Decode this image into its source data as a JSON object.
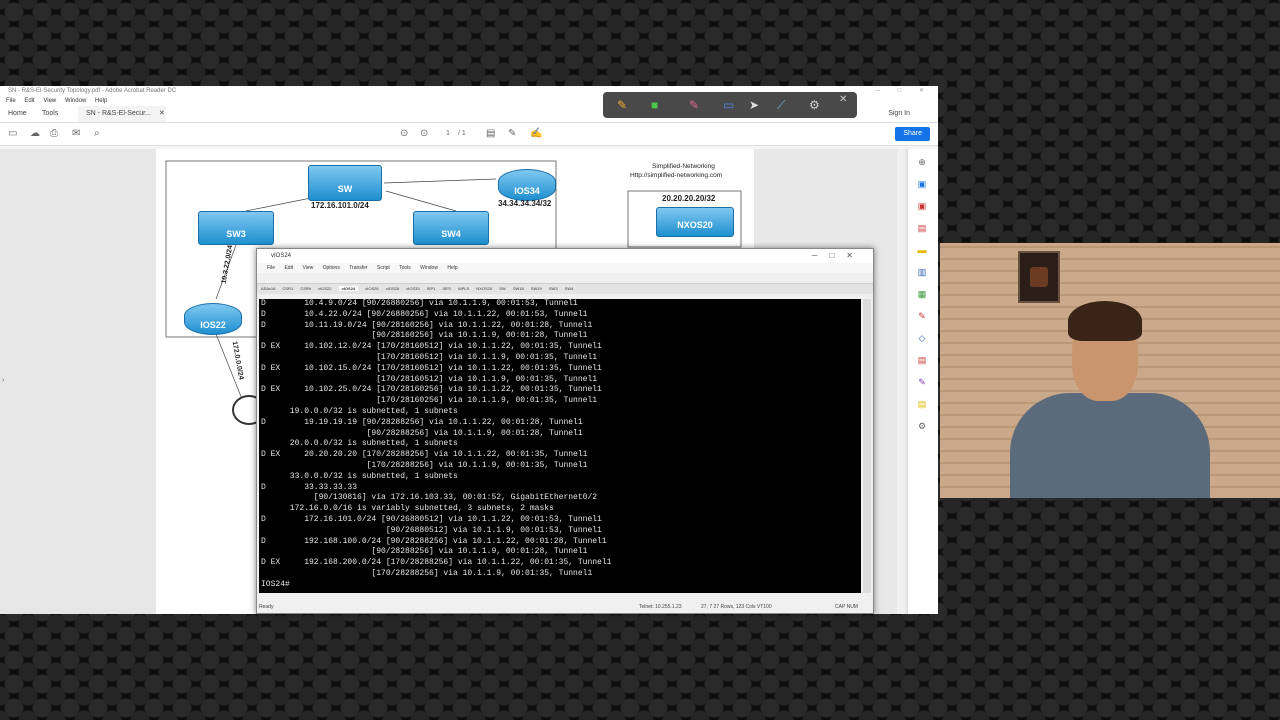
{
  "acrobat": {
    "window_title": "SN - R&S-El-Security Topology.pdf - Adobe Acrobat Reader DC",
    "menu": [
      "File",
      "Edit",
      "View",
      "Window",
      "Help"
    ],
    "tab_home": "Home",
    "tab_tools": "Tools",
    "tab_doc": "SN - R&S-El-Secur...",
    "signin": "Sign In",
    "page_current": "1",
    "page_total": "/ 1",
    "share": "Share"
  },
  "topology": {
    "sw_label": "SW",
    "sw_subnet": "172.16.101.0/24",
    "sw3_label": "SW3",
    "sw4_label": "SW4",
    "ios34_label": "IOS34",
    "ios34_subnet": "34.34.34.34/32",
    "ios22_label": "IOS22",
    "link1": "10.3.22.0/24",
    "link2": "172.0.0.0/24",
    "brand": "Simplified-Networking",
    "url": "Http://simplified-networking.com",
    "nxos20_subnet": "20.20.20.20/32",
    "nxos20_label": "NXOS20"
  },
  "crt": {
    "window_title": "vIOS24",
    "menu": [
      "File",
      "Edit",
      "View",
      "Options",
      "Transfer",
      "Script",
      "Tools",
      "Window",
      "Help"
    ],
    "tabs": [
      "ASAv16",
      "CSR1",
      "CSR9",
      "vIOS22",
      "vIOS24",
      "vIOS26",
      "vIOS28",
      "vIOS33",
      "ISP1",
      "ISP2",
      "MPLS",
      "NXOS20",
      "SW",
      "SW18",
      "SW19",
      "SW3",
      "SW4"
    ],
    "active_tab": "vIOS24",
    "terminal_lines": [
      "D        10.4.9.0/24 [90/26880256] via 10.1.1.9, 00:01:53, Tunnel1",
      "D        10.4.22.0/24 [90/26880256] via 10.1.1.22, 00:01:53, Tunnel1",
      "D        10.11.19.0/24 [90/28160256] via 10.1.1.22, 00:01:28, Tunnel1",
      "                       [90/28160256] via 10.1.1.9, 00:01:28, Tunnel1",
      "D EX     10.102.12.0/24 [170/28160512] via 10.1.1.22, 00:01:35, Tunnel1",
      "                        [170/28160512] via 10.1.1.9, 00:01:35, Tunnel1",
      "D EX     10.102.15.0/24 [170/28160512] via 10.1.1.22, 00:01:35, Tunnel1",
      "                        [170/28160512] via 10.1.1.9, 00:01:35, Tunnel1",
      "D EX     10.102.25.0/24 [170/28160256] via 10.1.1.22, 00:01:35, Tunnel1",
      "                        [170/28160256] via 10.1.1.9, 00:01:35, Tunnel1",
      "      19.0.0.0/32 is subnetted, 1 subnets",
      "D        19.19.19.19 [90/28288256] via 10.1.1.22, 00:01:28, Tunnel1",
      "                      [90/28288256] via 10.1.1.9, 00:01:28, Tunnel1",
      "      20.0.0.0/32 is subnetted, 1 subnets",
      "D EX     20.20.20.20 [170/28288256] via 10.1.1.22, 00:01:35, Tunnel1",
      "                      [170/28288256] via 10.1.1.9, 00:01:35, Tunnel1",
      "      33.0.0.0/32 is subnetted, 1 subnets",
      "D        33.33.33.33",
      "           [90/130816] via 172.16.103.33, 00:01:52, GigabitEthernet0/2",
      "      172.16.0.0/16 is variably subnetted, 3 subnets, 2 masks",
      "D        172.16.101.0/24 [90/26880512] via 10.1.1.22, 00:01:53, Tunnel1",
      "                          [90/26880512] via 10.1.1.9, 00:01:53, Tunnel1",
      "D        192.168.100.0/24 [90/28288256] via 10.1.1.22, 00:01:28, Tunnel1",
      "                       [90/28288256] via 10.1.1.9, 00:01:28, Tunnel1",
      "D EX     192.168.200.0/24 [170/28288256] via 10.1.1.22, 00:01:35, Tunnel1",
      "                       [170/28288256] via 10.1.1.9, 00:01:35, Tunnel1",
      "IOS24#"
    ],
    "status_ready": "Ready",
    "status_conn": "Telnet: 10.255.1.23",
    "status_pos": "27,  7   27 Rows, 123 Cols  VT100",
    "status_caps": "CAP  NUM"
  },
  "colors": {
    "share_blue": "#1473e6",
    "device_blue": "#1e8fd0",
    "terminal_bg": "#000000"
  }
}
